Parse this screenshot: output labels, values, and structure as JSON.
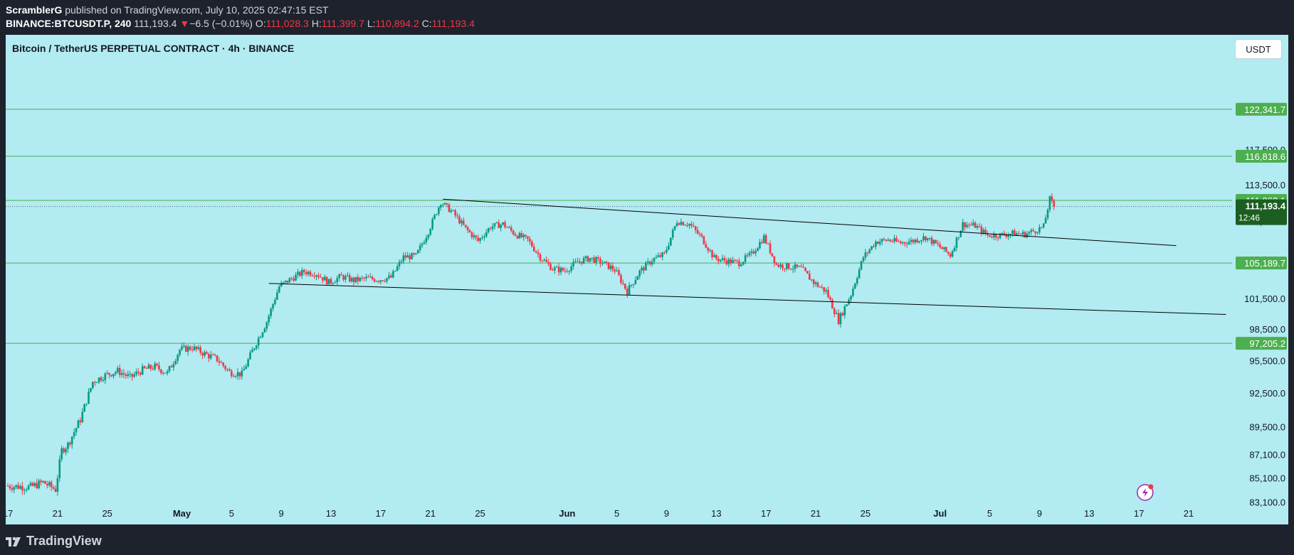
{
  "header": {
    "author": "ScramblerG",
    "published_text": "published on TradingView.com, July 10, 2025 02:47:15 EST",
    "symbol": "BINANCE:BTCUSDT.P, 240",
    "last": "111,193.4",
    "change_arrow": "▼",
    "change": "−6.5 (−0.01%)",
    "o_label": "O:",
    "o_value": "111,028.3",
    "h_label": "H:",
    "h_value": "111,399.7",
    "l_label": "L:",
    "l_value": "110,894.2",
    "c_label": "C:",
    "c_value": "111,193.4"
  },
  "chart_title": "Bitcoin / TetherUS PERPETUAL CONTRACT · 4h · BINANCE",
  "currency_button": "USDT",
  "brand": "TradingView",
  "colors": {
    "background": "#b2ebf2",
    "frame": "#1e222d",
    "up": "#089981",
    "down": "#f23645",
    "level_line": "#4caf50",
    "level_label": "#4caf50",
    "last_price_label": "#1b5e20",
    "trendline": "#000000"
  },
  "icons": {
    "lightning": "lightning-icon",
    "logo": "tradingview-logo-icon"
  },
  "chart_data": {
    "type": "candlestick",
    "interval": "4h",
    "x_axis": {
      "ticks": [
        "17",
        "21",
        "25",
        "May",
        "5",
        "9",
        "13",
        "17",
        "21",
        "25",
        "Jun",
        "5",
        "9",
        "13",
        "17",
        "21",
        "25",
        "Jul",
        "5",
        "9",
        "13",
        "17",
        "21"
      ],
      "bold_ticks": [
        "May",
        "Jun",
        "Jul"
      ]
    },
    "y_axis": {
      "ticks": [
        {
          "label": "83,100.0",
          "value": 83100
        },
        {
          "label": "85,100.0",
          "value": 85100
        },
        {
          "label": "87,100.0",
          "value": 87100
        },
        {
          "label": "89,500.0",
          "value": 89500
        },
        {
          "label": "92,500.0",
          "value": 92500
        },
        {
          "label": "95,500.0",
          "value": 95500
        },
        {
          "label": "98,500.0",
          "value": 98500
        },
        {
          "label": "101,500.0",
          "value": 101500
        },
        {
          "label": "105,500.0",
          "value": 105500
        },
        {
          "label": "109,500.0",
          "value": 109500
        },
        {
          "label": "113,500.0",
          "value": 113500
        },
        {
          "label": "117,500.0",
          "value": 117500
        }
      ],
      "range": [
        81700,
        128000
      ]
    },
    "horizontal_levels": [
      {
        "label": "122,341.7",
        "value": 122341.7
      },
      {
        "label": "116,818.6",
        "value": 116818.6
      },
      {
        "label": "111,862.1",
        "value": 111862.1
      },
      {
        "label": "105,189.7",
        "value": 105189.7
      },
      {
        "label": "97,205.2",
        "value": 97205.2
      }
    ],
    "last_price": {
      "label": "111,193.4",
      "value": 111193.4,
      "countdown": "12:46"
    },
    "trendlines": [
      {
        "name": "upper",
        "from": [
          "May 22",
          112000
        ],
        "to": [
          "Jul 20",
          107000
        ]
      },
      {
        "name": "lower",
        "from": [
          "May 8",
          103100
        ],
        "to": [
          "Jul 24",
          100000
        ]
      }
    ],
    "path": [
      [
        "Apr 17",
        84500
      ],
      [
        "Apr 19",
        84400
      ],
      [
        "Apr 20",
        84800
      ],
      [
        "Apr 21",
        84200
      ],
      [
        "Apr 21.5",
        87500
      ],
      [
        "Apr 22",
        88000
      ],
      [
        "Apr 23",
        90200
      ],
      [
        "Apr 24",
        93600
      ],
      [
        "Apr 25",
        94200
      ],
      [
        "Apr 26",
        94600
      ],
      [
        "Apr 27",
        94000
      ],
      [
        "Apr 28",
        94700
      ],
      [
        "Apr 29",
        95000
      ],
      [
        "Apr 30",
        94400
      ],
      [
        "May 1",
        96600
      ],
      [
        "May 2",
        96800
      ],
      [
        "May 3",
        96200
      ],
      [
        "May 4",
        95700
      ],
      [
        "May 5",
        94500
      ],
      [
        "May 6",
        94300
      ],
      [
        "May 7",
        96900
      ],
      [
        "May 8",
        99300
      ],
      [
        "May 9",
        102800
      ],
      [
        "May 10",
        103600
      ],
      [
        "May 11",
        104300
      ],
      [
        "May 12",
        104100
      ],
      [
        "May 13",
        103200
      ],
      [
        "May 14",
        103800
      ],
      [
        "May 15",
        103400
      ],
      [
        "May 16",
        103600
      ],
      [
        "May 17",
        103500
      ],
      [
        "May 18",
        103700
      ],
      [
        "May 19",
        105800
      ],
      [
        "May 20",
        105900
      ],
      [
        "May 21",
        108500
      ],
      [
        "May 22",
        111700
      ],
      [
        "May 23",
        110500
      ],
      [
        "May 24",
        108800
      ],
      [
        "May 25",
        107500
      ],
      [
        "May 26",
        109000
      ],
      [
        "May 27",
        109300
      ],
      [
        "May 28",
        108200
      ],
      [
        "May 29",
        107600
      ],
      [
        "May 30",
        105800
      ],
      [
        "May 31",
        104600
      ],
      [
        "Jun 1",
        104400
      ],
      [
        "Jun 2",
        105300
      ],
      [
        "Jun 3",
        105700
      ],
      [
        "Jun 4",
        105200
      ],
      [
        "Jun 5",
        104500
      ],
      [
        "Jun 6",
        102300
      ],
      [
        "Jun 7",
        104300
      ],
      [
        "Jun 8",
        105500
      ],
      [
        "Jun 9",
        106100
      ],
      [
        "Jun 10",
        109600
      ],
      [
        "Jun 11",
        109300
      ],
      [
        "Jun 12",
        107800
      ],
      [
        "Jun 13",
        105700
      ],
      [
        "Jun 14",
        105400
      ],
      [
        "Jun 15",
        105200
      ],
      [
        "Jun 16",
        106100
      ],
      [
        "Jun 17",
        107900
      ],
      [
        "Jun 18",
        105000
      ],
      [
        "Jun 19",
        104800
      ],
      [
        "Jun 20",
        104600
      ],
      [
        "Jun 21",
        103200
      ],
      [
        "Jun 22",
        102300
      ],
      [
        "Jun 23",
        99400
      ],
      [
        "Jun 24",
        102000
      ],
      [
        "Jun 25",
        105800
      ],
      [
        "Jun 26",
        107400
      ],
      [
        "Jun 27",
        107600
      ],
      [
        "Jun 28",
        107300
      ],
      [
        "Jun 29",
        107500
      ],
      [
        "Jun 30",
        107900
      ],
      [
        "Jul 1",
        107000
      ],
      [
        "Jul 2",
        106000
      ],
      [
        "Jul 3",
        109300
      ],
      [
        "Jul 4",
        109100
      ],
      [
        "Jul 5",
        108100
      ],
      [
        "Jul 6",
        108100
      ],
      [
        "Jul 7",
        108300
      ],
      [
        "Jul 8",
        108200
      ],
      [
        "Jul 9",
        108700
      ],
      [
        "Jul 9.5",
        109000
      ],
      [
        "Jul 10",
        112000
      ],
      [
        "Jul 10.3",
        111193.4
      ]
    ]
  }
}
